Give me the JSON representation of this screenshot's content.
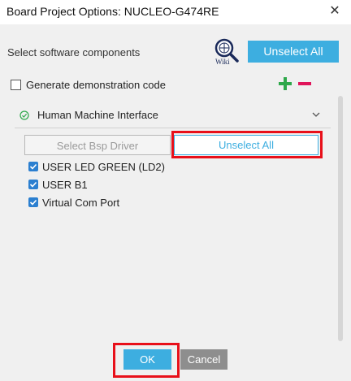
{
  "window": {
    "title": "Board Project Options: NUCLEO-G474RE",
    "close_icon": "close-icon"
  },
  "toolbar": {
    "select_label": "Select software components",
    "wiki_icon": "wiki-search-icon",
    "wiki_text": "Wiki",
    "unselect_all_label": "Unselect All"
  },
  "options": {
    "demo_label": "Generate demonstration code",
    "demo_checked": false,
    "expand_icon": "plus-icon",
    "collapse_icon": "minus-icon"
  },
  "component": {
    "title": "Human Machine Interface",
    "status_icon": "check-circle-icon",
    "chevron_icon": "chevron-down-icon",
    "bsp_driver_label": "Select Bsp Driver",
    "unselect_all_label": "Unselect All",
    "items": [
      {
        "label": "USER LED GREEN (LD2)",
        "checked": true
      },
      {
        "label": "USER B1",
        "checked": true
      },
      {
        "label": "Virtual Com Port",
        "checked": true
      }
    ]
  },
  "footer": {
    "ok_label": "OK",
    "cancel_label": "Cancel"
  },
  "colors": {
    "accent": "#3daee0",
    "highlight": "#e8101a",
    "plus": "#2ea84a",
    "minus": "#e0145a",
    "checkbox": "#2b7fd0"
  }
}
